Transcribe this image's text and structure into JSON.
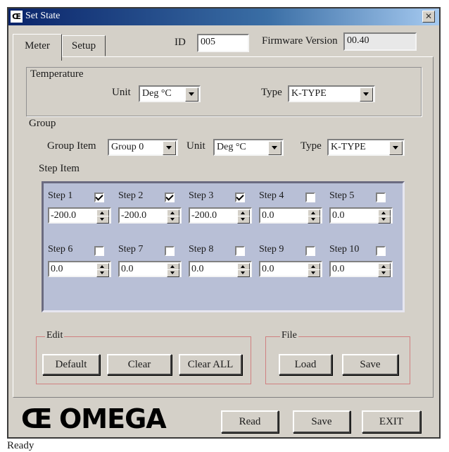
{
  "window": {
    "title": "Set State",
    "icon_text": "Œ",
    "close_symbol": "✕"
  },
  "tabs": [
    {
      "label": "Meter",
      "active": true
    },
    {
      "label": "Setup",
      "active": false
    }
  ],
  "header": {
    "id_label": "ID",
    "id_value": "005",
    "firmware_label": "Firmware Version",
    "firmware_value": "00.40"
  },
  "temperature": {
    "section_label": "Temperature",
    "unit_label": "Unit",
    "unit_value": "Deg °C",
    "type_label": "Type",
    "type_value": "K-TYPE"
  },
  "group": {
    "section_label": "Group",
    "item_label": "Group Item",
    "item_value": "Group 0",
    "unit_label": "Unit",
    "unit_value": "Deg °C",
    "type_label": "Type",
    "type_value": "K-TYPE",
    "step_item_label": "Step Item"
  },
  "steps": [
    {
      "label": "Step 1",
      "checked": true,
      "value": "-200.0"
    },
    {
      "label": "Step 2",
      "checked": true,
      "value": "-200.0"
    },
    {
      "label": "Step 3",
      "checked": true,
      "value": "-200.0"
    },
    {
      "label": "Step 4",
      "checked": false,
      "value": "0.0"
    },
    {
      "label": "Step 5",
      "checked": false,
      "value": "0.0"
    },
    {
      "label": "Step 6",
      "checked": false,
      "value": "0.0"
    },
    {
      "label": "Step 7",
      "checked": false,
      "value": "0.0"
    },
    {
      "label": "Step 8",
      "checked": false,
      "value": "0.0"
    },
    {
      "label": "Step 9",
      "checked": false,
      "value": "0.0"
    },
    {
      "label": "Step 10",
      "checked": false,
      "value": "0.0"
    }
  ],
  "edit": {
    "legend": "Edit",
    "default_label": "Default",
    "clear_label": "Clear",
    "clear_all_label": "Clear ALL"
  },
  "file": {
    "legend": "File",
    "load_label": "Load",
    "save_label": "Save"
  },
  "footer": {
    "logo_text": "OMEGA",
    "logo_mark": "Œ",
    "read_label": "Read",
    "save_label": "Save",
    "exit_label": "EXIT"
  },
  "status": {
    "text": "Ready"
  },
  "colors": {
    "title_start": "#0a246a",
    "step_area": "#b8bfd6",
    "edit_border": "#d08080"
  }
}
